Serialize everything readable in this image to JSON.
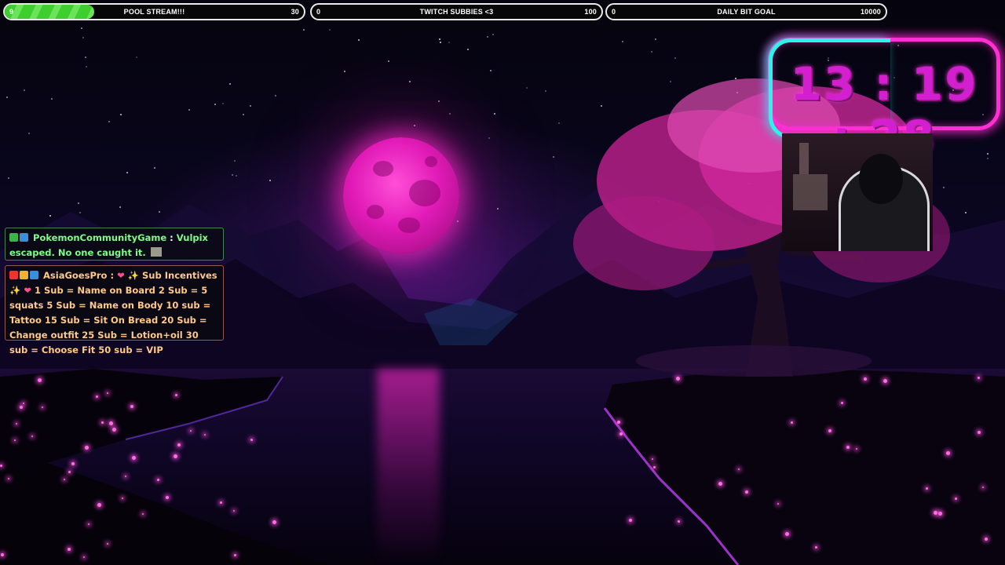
{
  "goals": [
    {
      "id": "pool-stream",
      "title": "POOL STREAM!!!",
      "current": "9",
      "max": "30",
      "progress": 0.3
    },
    {
      "id": "twitch-subbies",
      "title": "TWITCH SUBBIES <3",
      "current": "0",
      "max": "100",
      "progress": 0.0
    },
    {
      "id": "daily-bit-goal",
      "title": "DAILY BIT GOAL",
      "current": "0",
      "max": "10000",
      "progress": 0.0
    }
  ],
  "timer": {
    "text": "13 : 19 : 28"
  },
  "chat": [
    {
      "username": "PokemonCommunityGame",
      "separator": " : ",
      "message": "Vulpix escaped. No one caught it.",
      "name_color": "#7dfc86",
      "badges": [
        "pencil-badge-icon",
        "prime-badge-icon"
      ]
    },
    {
      "username": "AsiaGoesPro",
      "separator": " : ",
      "message_before": " ✨ Sub Incentives ✨ ",
      "message": " 1 Sub = Name on Board 2 Sub = 5 squats 5 Sub = Name on Body 10 sub = Tattoo 15 Sub = Sit On Bread 20 Sub = Change outfit 25 Sub = Lotion+oil 30 sub = Choose Fit 50 sub = VIP",
      "name_color": "#ffc98a",
      "badges": [
        "broadcaster-badge-icon",
        "handshake-badge-icon",
        "prime-badge-icon"
      ]
    }
  ],
  "colors": {
    "goal_fill": "#3ecf2e",
    "timer_neon_pink": "#ff2fd2",
    "timer_neon_cyan": "#30f2e8",
    "timer_digits": "#d41fd0",
    "moon": "#e21bb8"
  }
}
